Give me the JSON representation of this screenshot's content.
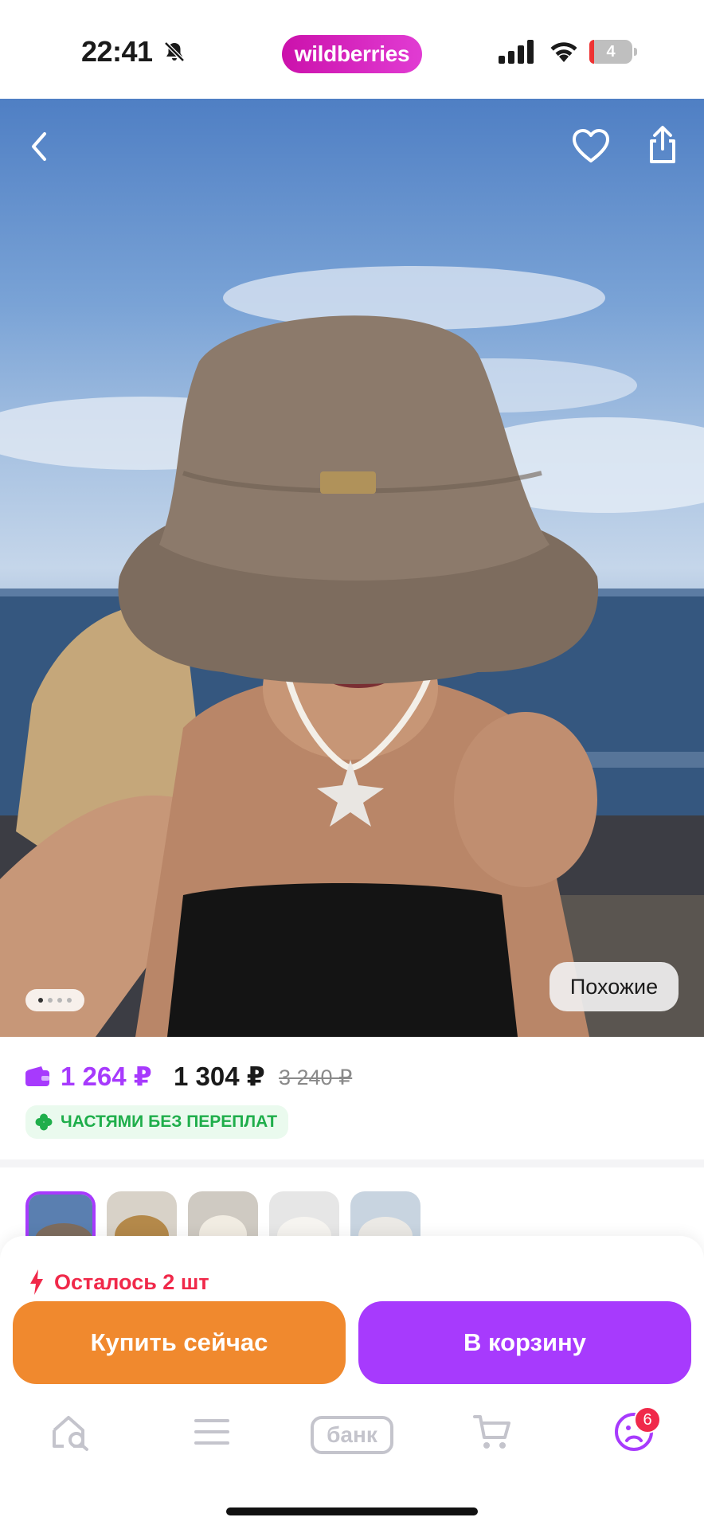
{
  "status_bar": {
    "time": "22:41",
    "brand": "wildberries",
    "battery_level": "4"
  },
  "product": {
    "gallery": {
      "similar_label": "Похожие",
      "current_photo": 1,
      "photo_count": 4
    },
    "price_wallet": "1 264 ₽",
    "price_main": "1 304 ₽",
    "price_old": "3 240 ₽",
    "installment_label": "ЧАСТЯМИ БЕЗ ПЕРЕПЛАТ",
    "stock_text": "Осталось 2 шт"
  },
  "thumbnails": [
    {
      "selected": true
    },
    {
      "selected": false
    },
    {
      "selected": false
    },
    {
      "selected": false
    },
    {
      "selected": false
    }
  ],
  "actions": {
    "buy_now_label": "Купить сейчас",
    "add_to_cart_label": "В корзину"
  },
  "tab_bar": {
    "items": [
      "home-search-icon",
      "menu-icon",
      "bank",
      "cart-icon",
      "profile-icon"
    ],
    "bank_label": "банк",
    "profile_badge": "6"
  },
  "colors": {
    "brand": "#cb11ab",
    "accent_purple": "#a73afd",
    "buy_orange": "#f0892e",
    "stock_red": "#f0294a",
    "installment_green": "#1fae4b"
  }
}
